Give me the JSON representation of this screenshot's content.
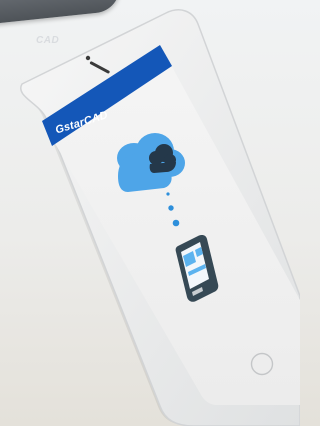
{
  "header": {
    "badge_text": "CAD"
  },
  "app": {
    "brand_name": "GstarCAD",
    "header_color": "#1457b8"
  },
  "illustration": {
    "cloud_color": "#4ea5e8",
    "mini_cloud_color": "#24384a",
    "dots_color": "#2d8fdb",
    "device_color": "#364955",
    "device_panel_color": "#5cb3ef"
  }
}
